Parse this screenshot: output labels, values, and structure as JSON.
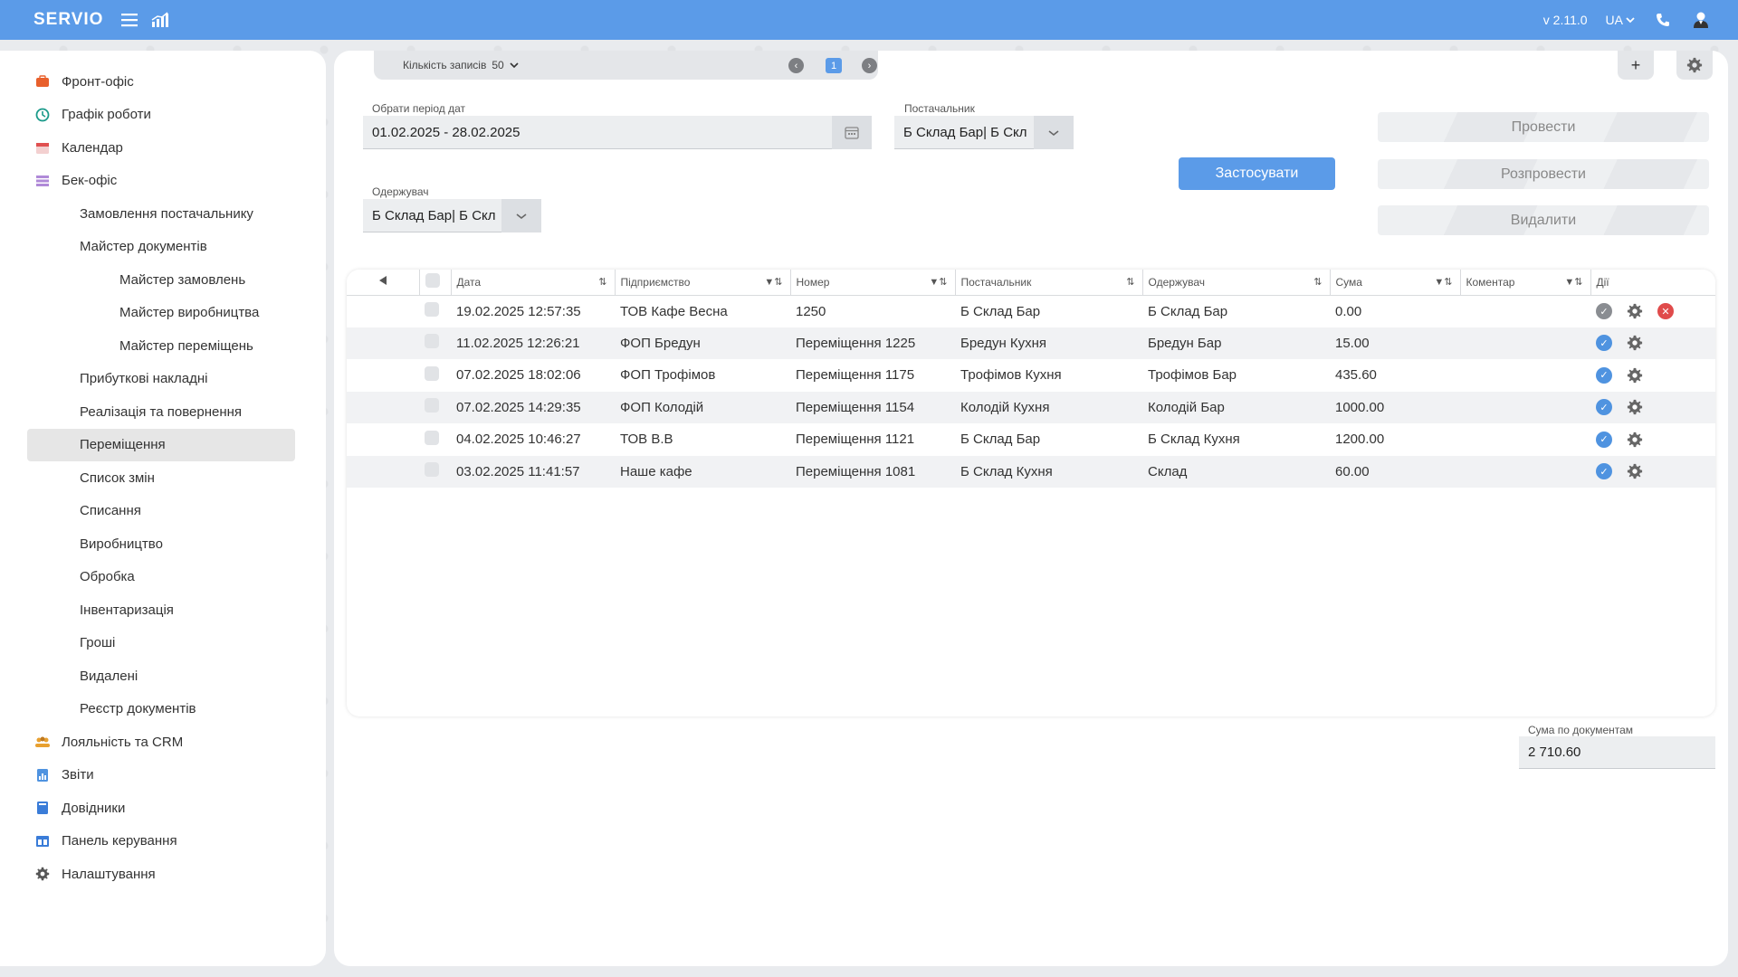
{
  "topbar": {
    "logo": "SERVIO",
    "version": "v 2.11.0",
    "language": "UA",
    "color": "#5b9be8"
  },
  "sidebar": {
    "items": [
      {
        "label": "Фронт-офіс",
        "level": 0,
        "icon": "briefcase-icon",
        "color": "#e8602c"
      },
      {
        "label": "Графік роботи",
        "level": 0,
        "icon": "clock-icon",
        "color": "#1a9a8a"
      },
      {
        "label": "Календар",
        "level": 0,
        "icon": "calendar-icon",
        "color": "#e05050"
      },
      {
        "label": "Бек-офіс",
        "level": 0,
        "icon": "list-icon",
        "color": "#b08ad8"
      },
      {
        "label": "Замовлення постачальнику",
        "level": 1
      },
      {
        "label": "Майстер документів",
        "level": 1
      },
      {
        "label": "Майстер замовлень",
        "level": 2
      },
      {
        "label": "Майстер виробництва",
        "level": 2
      },
      {
        "label": "Майстер переміщень",
        "level": 2
      },
      {
        "label": "Прибуткові накладні",
        "level": 1
      },
      {
        "label": "Реалізація та повернення",
        "level": 1
      },
      {
        "label": "Переміщення",
        "level": 1,
        "active": true
      },
      {
        "label": "Список змін",
        "level": 1
      },
      {
        "label": "Списання",
        "level": 1
      },
      {
        "label": "Виробництво",
        "level": 1
      },
      {
        "label": "Обробка",
        "level": 1
      },
      {
        "label": "Інвентаризація",
        "level": 1
      },
      {
        "label": "Гроші",
        "level": 1
      },
      {
        "label": "Видалені",
        "level": 1
      },
      {
        "label": "Реєстр документів",
        "level": 1
      },
      {
        "label": "Лояльність та CRM",
        "level": 0,
        "icon": "people-icon",
        "color": "#e8a030"
      },
      {
        "label": "Звіти",
        "level": 0,
        "icon": "report-icon",
        "color": "#4f93e0"
      },
      {
        "label": "Довідники",
        "level": 0,
        "icon": "book-icon",
        "color": "#3a7cd8"
      },
      {
        "label": "Панель керування",
        "level": 0,
        "icon": "dashboard-icon",
        "color": "#3a7cd8"
      },
      {
        "label": "Налаштування",
        "level": 0,
        "icon": "gear-icon",
        "color": "#555555"
      }
    ]
  },
  "pager": {
    "records_label": "Кількість записів",
    "records_value": "50",
    "current_page": "1"
  },
  "filters": {
    "period_label": "Обрати період дат",
    "period_value": "01.02.2025 - 28.02.2025",
    "supplier_label": "Постачальник",
    "supplier_value": "Б Склад Бар| Б Скл",
    "receiver_label": "Одержувач",
    "receiver_value": "Б Склад Бар| Б Скл",
    "apply_label": "Застосувати"
  },
  "actions": {
    "post": "Провести",
    "unpost": "Розпровести",
    "delete": "Видалити"
  },
  "table": {
    "columns": [
      "Дата",
      "Підприємство",
      "Номер",
      "Постачальник",
      "Одержувач",
      "Сума",
      "Коментар",
      "Дії"
    ],
    "rows": [
      {
        "date": "19.02.2025 12:57:35",
        "enterprise": "ТОВ Кафе Весна",
        "number": "1250",
        "supplier": "Б Склад Бар",
        "receiver": "Б Склад Бар",
        "sum": "0.00",
        "comment": "",
        "status": "pending"
      },
      {
        "date": "11.02.2025 12:26:21",
        "enterprise": "ФОП Бредун",
        "number": "Переміщення 1225",
        "supplier": "Бредун Кухня",
        "receiver": "Бредун Бар",
        "sum": "15.00",
        "comment": "",
        "status": "posted"
      },
      {
        "date": "07.02.2025 18:02:06",
        "enterprise": "ФОП Трофімов",
        "number": "Переміщення 1175",
        "supplier": "Трофімов Кухня",
        "receiver": "Трофімов Бар",
        "sum": "435.60",
        "comment": "",
        "status": "posted"
      },
      {
        "date": "07.02.2025 14:29:35",
        "enterprise": "ФОП Колодій",
        "number": "Переміщення 1154",
        "supplier": "Колодій Кухня",
        "receiver": "Колодій Бар",
        "sum": "1000.00",
        "comment": "",
        "status": "posted"
      },
      {
        "date": "04.02.2025 10:46:27",
        "enterprise": "ТОВ В.В",
        "number": "Переміщення 1121",
        "supplier": "Б Склад Бар",
        "receiver": "Б Склад Кухня",
        "sum": "1200.00",
        "comment": "",
        "status": "posted"
      },
      {
        "date": "03.02.2025 11:41:57",
        "enterprise": "Наше кафе",
        "number": "Переміщення 1081",
        "supplier": "Б Склад Кухня",
        "receiver": "Склад",
        "sum": "60.00",
        "comment": "",
        "status": "posted"
      }
    ]
  },
  "totals": {
    "label": "Сума по документам",
    "value": "2 710.60"
  }
}
